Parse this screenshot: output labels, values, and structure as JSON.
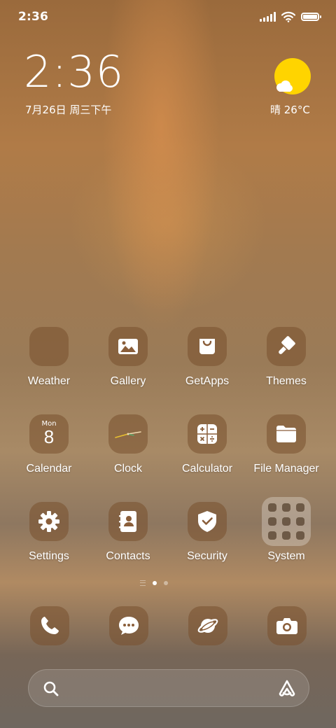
{
  "status_bar": {
    "time": "2:36",
    "icons": [
      "signal-icon",
      "wifi-icon",
      "battery-icon"
    ]
  },
  "clock_widget": {
    "time": "2:36",
    "date": "7月26日 周三下午"
  },
  "weather_widget": {
    "condition_temp": "晴 26°C",
    "icon": "sun-cloud-icon",
    "sun_color": "#ffd400"
  },
  "apps": {
    "weather": "Weather",
    "gallery": "Gallery",
    "getapps": "GetApps",
    "themes": "Themes",
    "calendar": "Calendar",
    "calendar_dow": "Mon",
    "calendar_day": "8",
    "clock": "Clock",
    "calculator": "Calculator",
    "file_manager": "File Manager",
    "settings": "Settings",
    "contacts": "Contacts",
    "security": "Security",
    "system": "System"
  },
  "page_indicator": {
    "pages": 2,
    "active_page": 1
  },
  "dock": [
    "phone-icon",
    "messages-icon",
    "browser-icon",
    "camera-icon"
  ],
  "search_bar": {
    "left_icon": "search-icon",
    "right_icon": "assistant-icon"
  }
}
